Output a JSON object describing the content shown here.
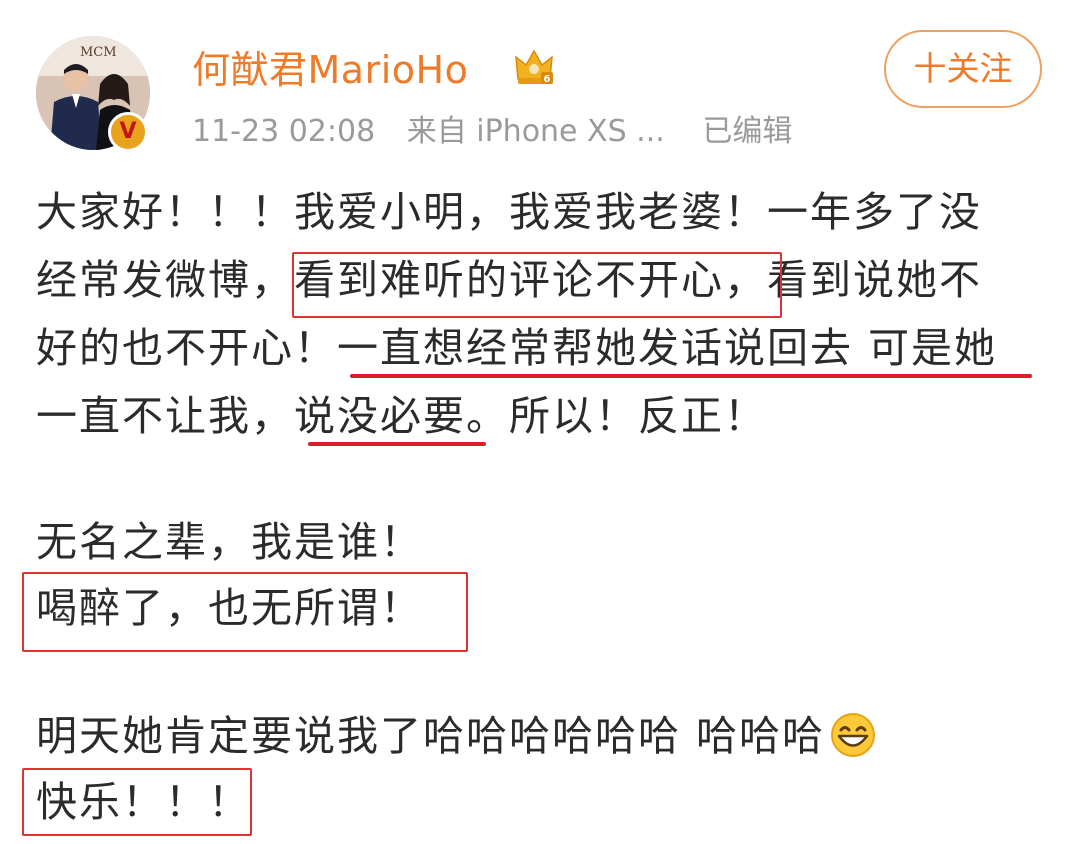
{
  "post": {
    "author": {
      "name": "何猷君MarioHo",
      "avatar_icon": "avatar-photo",
      "verified_badge": "V",
      "member_icon": "crown-icon"
    },
    "meta": {
      "time": "11-23 02:08",
      "source": "来自 iPhone XS ...",
      "edited": "已编辑"
    },
    "follow_button": "十关注",
    "paragraph1": {
      "line1": "大家好！！！我爱小明，我爱我老婆！一年多了没",
      "line2_a": "经常发微博，",
      "line2_b": "看到难听的评论不开心，",
      "line2_c": "看到说她不",
      "line3_a": "好的也不开心！",
      "line3_b": "一直想经常帮她发话说回去 可是她",
      "line4_a": "一直不让我，",
      "line4_b": "说没必要",
      "line4_c": "。所以！反正！"
    },
    "paragraph2": {
      "line1": "无名之辈，我是谁！",
      "line2": "喝醉了，也无所谓！"
    },
    "paragraph3": {
      "line1": "明天她肯定要说我了哈哈哈哈哈哈 哈哈哈",
      "emoji": "grinning-face-icon",
      "line2": "快乐！！！"
    }
  },
  "colors": {
    "username": "#ee7b2a",
    "meta": "#9a9a9a",
    "body_text": "#2b2b2b",
    "annotation_red": "#e23232",
    "follow_border": "#f0a05a"
  }
}
